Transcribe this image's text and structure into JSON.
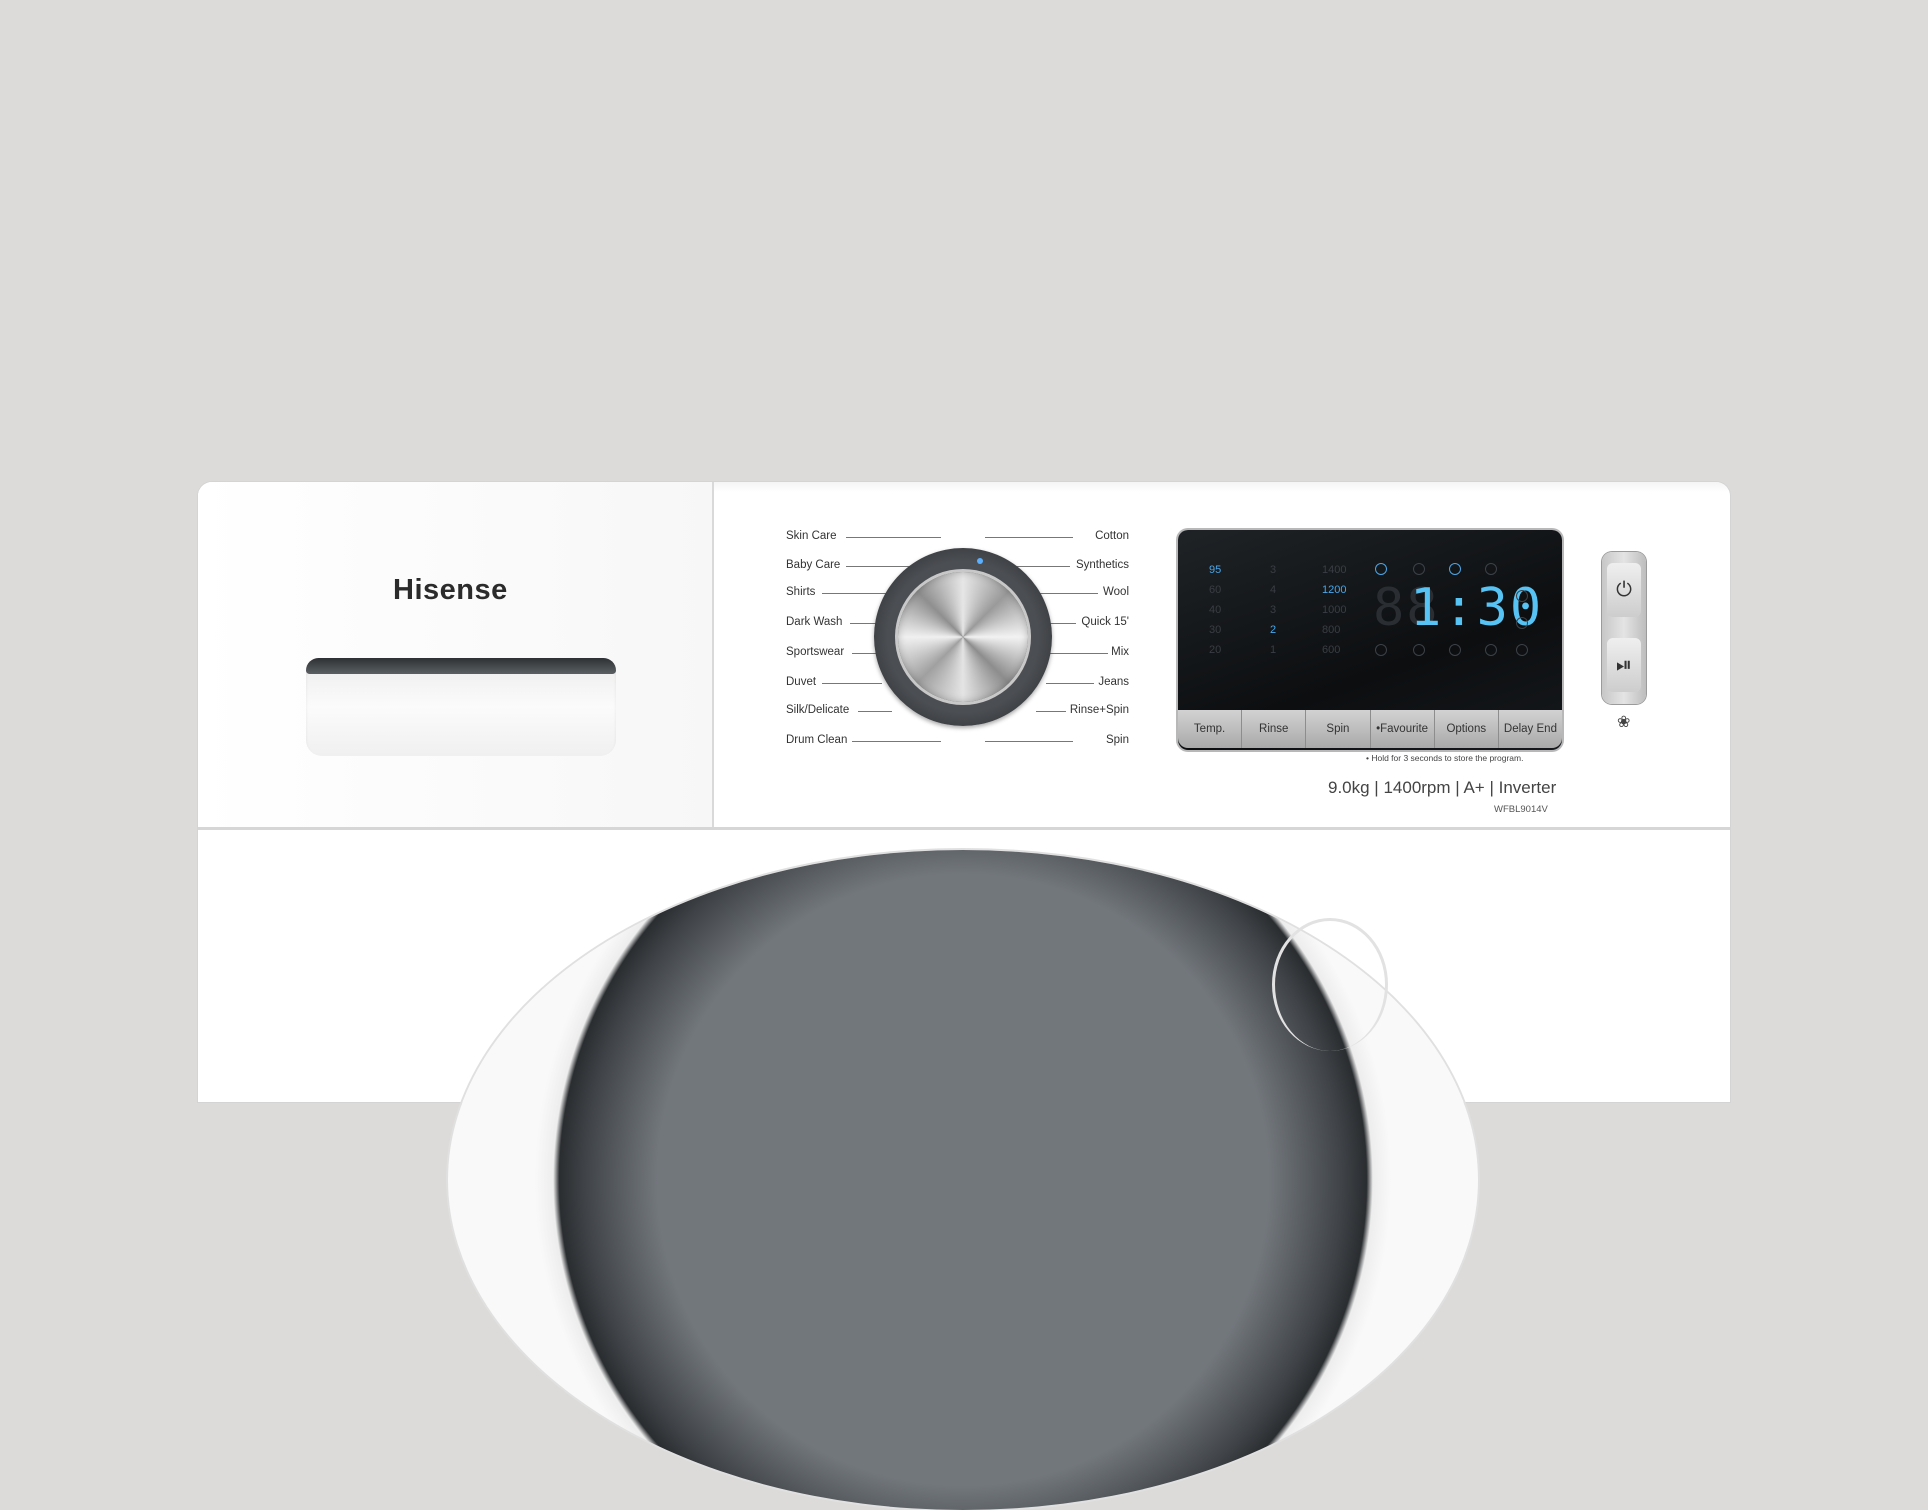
{
  "brand": "Hisense",
  "programs_left": [
    "Skin Care",
    "Baby Care",
    "Shirts",
    "Dark Wash",
    "Sportswear",
    "Duvet",
    "Silk/Delicate",
    "Drum Clean"
  ],
  "programs_right": [
    "Cotton",
    "Synthetics",
    "Wool",
    "Quick 15'",
    "Mix",
    "Jeans",
    "Rinse+Spin",
    "Spin"
  ],
  "display": {
    "temps": [
      "95",
      "60",
      "40",
      "30",
      "20"
    ],
    "rinse": [
      "3",
      "4",
      "3",
      "2",
      "1"
    ],
    "spin": [
      "1400",
      "1200",
      "1000",
      "800",
      "600"
    ],
    "time": "1:30",
    "time_ghost": "88"
  },
  "buttons": [
    "Temp.",
    "Rinse",
    "Spin",
    "•Favourite",
    "Options",
    "Delay End"
  ],
  "hold_note": "• Hold for 3 seconds to store the program.",
  "spec_line": "9.0kg | 1400rpm | A+ | Inverter",
  "model": "WFBL9014V",
  "icons": {
    "power": "power-icon",
    "play_pause": "play-pause-icon",
    "child_lock": "tshirt-lock-icon"
  },
  "colors": {
    "display_lit": "#57c3f5",
    "body": "#ffffff",
    "background": "#dcdbd9"
  }
}
